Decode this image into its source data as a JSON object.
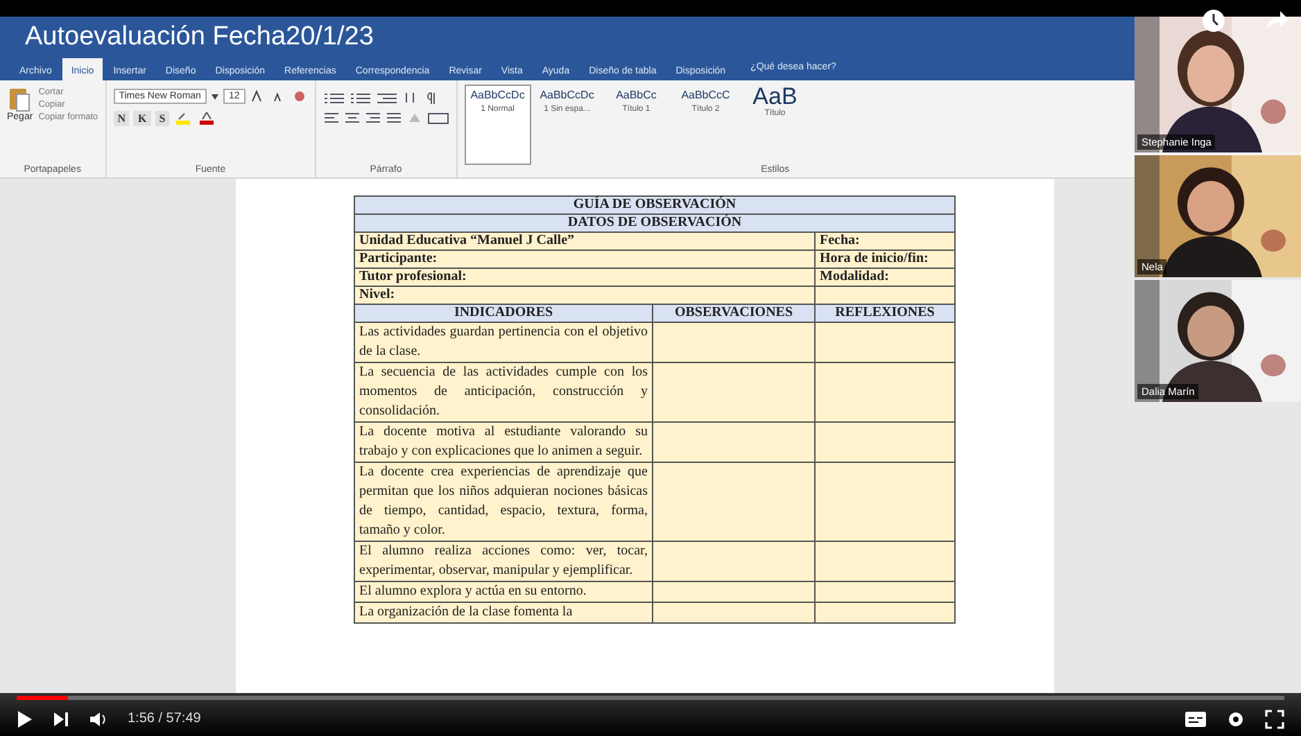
{
  "window": {
    "title": "Autoevaluación Fecha20/1/23"
  },
  "ribbon_tabs": [
    {
      "label": "Archivo",
      "selected": false
    },
    {
      "label": "Inicio",
      "selected": true
    },
    {
      "label": "Insertar",
      "selected": false
    },
    {
      "label": "Diseño",
      "selected": false
    },
    {
      "label": "Disposición",
      "selected": false
    },
    {
      "label": "Referencias",
      "selected": false
    },
    {
      "label": "Correspondencia",
      "selected": false
    },
    {
      "label": "Revisar",
      "selected": false
    },
    {
      "label": "Vista",
      "selected": false
    },
    {
      "label": "Ayuda",
      "selected": false
    },
    {
      "label": "Diseño de tabla",
      "selected": false
    },
    {
      "label": "Disposición",
      "selected": false
    }
  ],
  "search_hint": "¿Qué desea hacer?",
  "clipboard": {
    "paste": "Pegar",
    "items": [
      "Cortar",
      "Copiar",
      "Copiar formato"
    ]
  },
  "font": {
    "name": "Times New Roman",
    "size": "12",
    "buttons": [
      "N",
      "K",
      "S"
    ]
  },
  "styles": [
    {
      "preview": "AaBbCcDc",
      "name": "1 Normal",
      "selected": true
    },
    {
      "preview": "AaBbCcDc",
      "name": "1 Sin espa...",
      "selected": false
    },
    {
      "preview": "AaBbCc",
      "name": "Título 1",
      "selected": false
    },
    {
      "preview": "AaBbCcC",
      "name": "Título 2",
      "selected": false
    },
    {
      "preview": "AaB",
      "name": "Título",
      "selected": false
    }
  ],
  "groups": [
    "Portapapeles",
    "Fuente",
    "Párrafo",
    "Estilos"
  ],
  "document": {
    "title_rows": [
      "GUÍA DE OBSERVACIÓN",
      "DATOS DE OBSERVACIÓN"
    ],
    "info_rows": [
      {
        "left": "Unidad Educativa “Manuel J Calle”",
        "right": "Fecha:"
      },
      {
        "left": "Participante:",
        "right": "Hora de inicio/fin:"
      },
      {
        "left": "Tutor profesional:",
        "right": "Modalidad:"
      },
      {
        "left": "Nivel:"
      }
    ],
    "columns": [
      "INDICADORES",
      "OBSERVACIONES",
      "REFLEXIONES"
    ],
    "indicators": [
      "Las actividades guardan pertinencia con el objetivo de la clase.",
      "La secuencia de las actividades cumple con los momentos de anticipación, construcción y consolidación.",
      "La docente motiva al estudiante valorando su trabajo y con explicaciones que lo animen a seguir.",
      "La docente crea experiencias de aprendizaje que permitan que los niños adquieran nociones básicas de tiempo, cantidad, espacio, textura, forma, tamaño y color.",
      "El alumno realiza acciones como: ver, tocar, experimentar, observar, manipular y ejemplificar.",
      "El alumno explora y actúa en su entorno.",
      "La organización de la clase fomenta la"
    ]
  },
  "participants": [
    {
      "name": "Stephanie Inga"
    },
    {
      "name": "Nela"
    },
    {
      "name": "Dalia Marín"
    }
  ],
  "player": {
    "time": "1:56 / 57:49",
    "level": 0.04
  }
}
